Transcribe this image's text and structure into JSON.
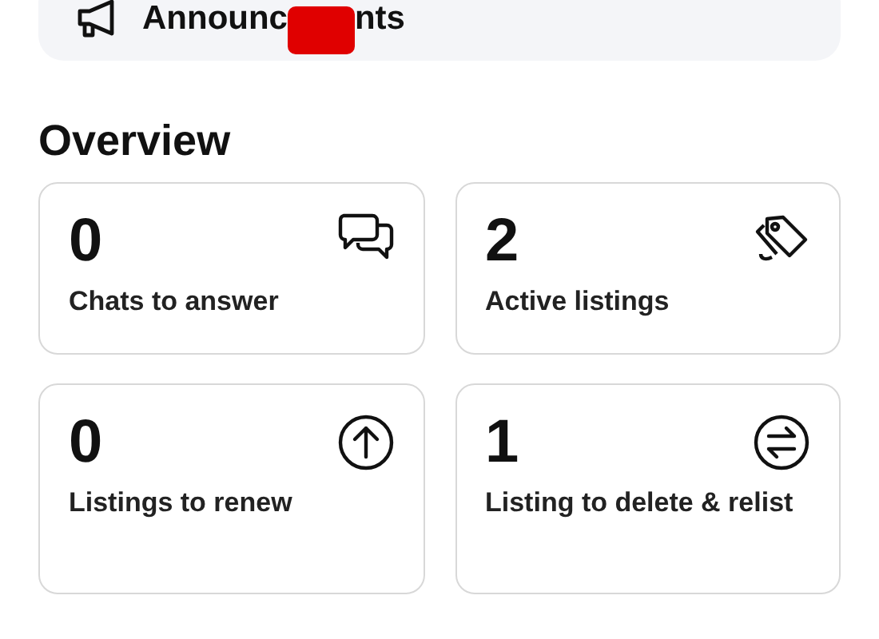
{
  "announcement": {
    "text_before": "Announc",
    "text_after": "nts"
  },
  "overview": {
    "title": "Overview",
    "cards": [
      {
        "kind": "chats",
        "count": "0",
        "label": "Chats to answer"
      },
      {
        "kind": "listings",
        "count": "2",
        "label": "Active listings"
      },
      {
        "kind": "renew",
        "count": "0",
        "label": "Listings to renew"
      },
      {
        "kind": "relist",
        "count": "1",
        "label": "Listing to delete & relist"
      }
    ]
  }
}
